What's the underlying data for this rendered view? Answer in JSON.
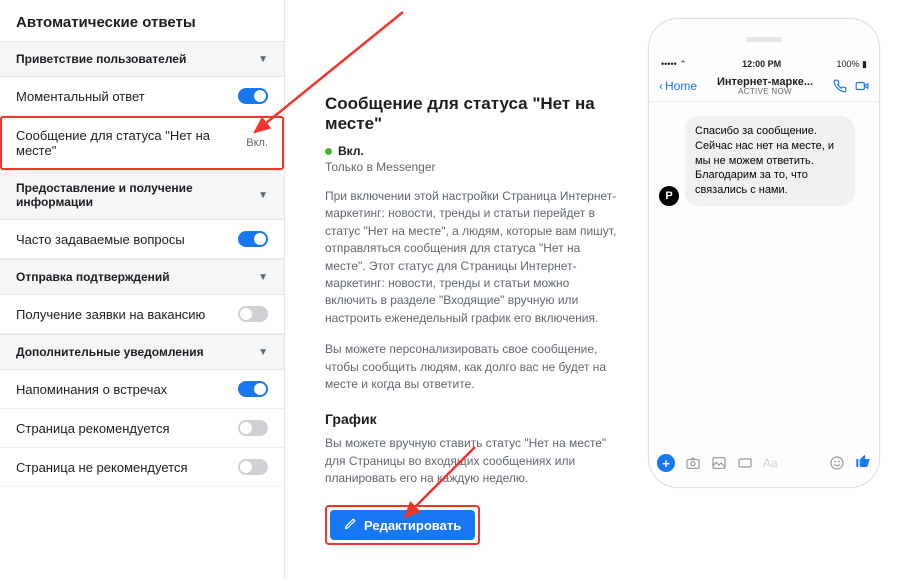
{
  "sidebar": {
    "title": "Автоматические ответы",
    "groups": [
      {
        "header": "Приветствие пользователей",
        "rows": [
          {
            "label": "Моментальный ответ",
            "state": "on"
          },
          {
            "label": "Сообщение для статуса \"Нет на месте\"",
            "pill": "Вкл."
          }
        ]
      },
      {
        "header": "Предоставление и получение информации",
        "rows": [
          {
            "label": "Часто задаваемые вопросы",
            "state": "on"
          }
        ]
      },
      {
        "header": "Отправка подтверждений",
        "rows": [
          {
            "label": "Получение заявки на вакансию",
            "state": "off"
          }
        ]
      },
      {
        "header": "Дополнительные уведомления",
        "rows": [
          {
            "label": "Напоминания о встречах",
            "state": "on"
          },
          {
            "label": "Страница рекомендуется",
            "state": "off"
          },
          {
            "label": "Страница не рекомендуется",
            "state": "off"
          }
        ]
      }
    ]
  },
  "content": {
    "heading": "Сообщение для статуса \"Нет на месте\"",
    "status": "Вкл.",
    "platform": "Только в Messenger",
    "para1": "При включении этой настройки Страница Интернет-маркетинг: новости, тренды и статьи перейдет в статус \"Нет на месте\", а людям, которые вам пишут, отправляться сообщения для статуса \"Нет на месте\". Этот статус для Страницы Интернет-маркетинг: новости, тренды и статьи можно включить в разделе \"Входящие\" вручную или настроить еженедельный график его включения.",
    "para2": "Вы можете персонализировать свое сообщение, чтобы сообщить людям, как долго вас не будет на месте и когда вы ответите.",
    "schedule_heading": "График",
    "para3": "Вы можете вручную ставить статус \"Нет на месте\" для Страницы во входящих сообщениях или планировать его на каждую неделю.",
    "edit_label": "Редактировать"
  },
  "phone": {
    "back_label": "Home",
    "time": "12:00 PM",
    "battery": "100%",
    "title": "Интернет-марке...",
    "subtitle": "active now",
    "bubble": "Спасибо за сообщение. Сейчас нас нет на месте, и мы не можем ответить. Благодарим за то, что связались с нами.",
    "composer_placeholder": "Aa"
  }
}
